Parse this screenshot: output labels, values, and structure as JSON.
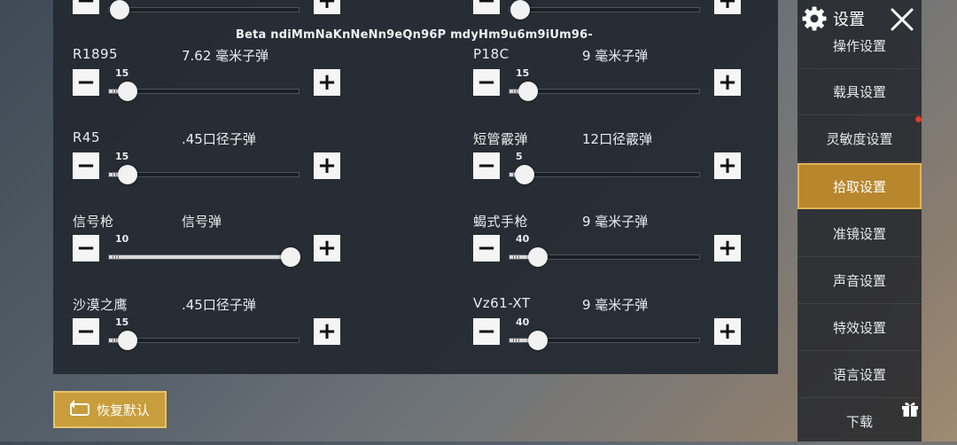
{
  "watermark": "Beta ndiMmNaKnNeNn9eQn96P mdyHm9u6m9iUm96-",
  "header": {
    "title": "设置"
  },
  "weapons": [
    {
      "name": "R1895",
      "ammo": "7.62 毫米子弹",
      "value": "15",
      "level": 0.05
    },
    {
      "name": "P18C",
      "ammo": "9 毫米子弹",
      "value": "15",
      "level": 0.05
    },
    {
      "name": "R45",
      "ammo": ".45口径子弹",
      "value": "15",
      "level": 0.05
    },
    {
      "name": "短管霰弹",
      "ammo": "12口径霰弹",
      "value": "5",
      "level": 0.03
    },
    {
      "name": "信号枪",
      "ammo": "信号弹",
      "value": "10",
      "level": 1.0
    },
    {
      "name": "蝎式手枪",
      "ammo": "9 毫米子弹",
      "value": "40",
      "level": 0.11
    },
    {
      "name": "沙漠之鹰",
      "ammo": ".45口径子弹",
      "value": "15",
      "level": 0.05
    },
    {
      "name": "Vz61-XT",
      "ammo": "9 毫米子弹",
      "value": "40",
      "level": 0.11
    }
  ],
  "buttons": {
    "minus": "−",
    "plus": "+",
    "reset": "恢复默认"
  },
  "sidebar": {
    "items": [
      {
        "label": "操作设置"
      },
      {
        "label": "载具设置"
      },
      {
        "label": "灵敏度设置"
      },
      {
        "label": "拾取设置"
      },
      {
        "label": "准镜设置"
      },
      {
        "label": "声音设置"
      },
      {
        "label": "特效设置"
      },
      {
        "label": "语言设置"
      },
      {
        "label": "下载"
      }
    ],
    "active": "拾取设置"
  },
  "colors": {
    "accent": "#c89d3b",
    "notification": "#e23a2a"
  },
  "icons": {
    "settings": "gear-icon",
    "close": "close-icon",
    "gift": "gift-icon",
    "reset": "reset-icon"
  }
}
